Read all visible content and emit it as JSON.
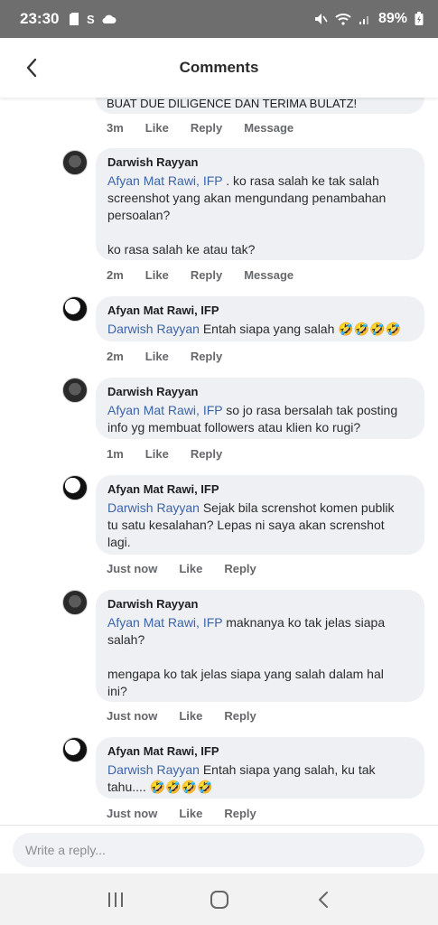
{
  "status_bar": {
    "time": "23:30",
    "battery": "89%"
  },
  "header": {
    "title": "Comments",
    "back_icon": "chevron-left-icon"
  },
  "cut_comment_text": "BUAT DUE DILIGENCE DAN TERIMA BULATZ!",
  "actions": {
    "like": "Like",
    "reply": "Reply",
    "message": "Message"
  },
  "comments": [
    {
      "time": "3m"
    },
    {
      "author": "Darwish Rayyan",
      "mention": "Afyan Mat Rawi, IFP",
      "lines": [
        " . ko rasa salah ke tak salah",
        "screenshot yang akan mengundang penambahan",
        "persoalan?",
        "",
        "ko rasa salah ke atau tak?"
      ],
      "time": "2m"
    },
    {
      "author": "Afyan Mat Rawi, IFP",
      "mention": "Darwish Rayyan",
      "lines": [
        " Entah siapa yang salah 🤣🤣🤣🤣"
      ],
      "time": "2m"
    },
    {
      "author": "Darwish Rayyan",
      "mention": "Afyan Mat Rawi, IFP",
      "lines": [
        " so jo rasa  bersalah tak posting",
        "info yg membuat followers atau klien ko rugi?"
      ],
      "time": "1m"
    },
    {
      "author": "Afyan Mat Rawi, IFP",
      "mention": "Darwish Rayyan",
      "lines": [
        " Sejak bila screnshot komen publik",
        "tu satu kesalahan? Lepas ni saya akan screnshot",
        "lagi."
      ],
      "time": "Just now"
    },
    {
      "author": "Darwish Rayyan",
      "mention": "Afyan Mat Rawi, IFP",
      "lines": [
        " maknanya ko tak jelas siapa",
        "salah?",
        "",
        "mengapa ko tak jelas siapa yang salah dalam hal",
        "ini?"
      ],
      "time": "Just now"
    },
    {
      "author": "Afyan Mat Rawi, IFP",
      "mention": "Darwish Rayyan",
      "lines": [
        " Entah siapa yang salah, ku tak",
        "tahu.... 🤣🤣🤣🤣"
      ],
      "time": "Just now"
    }
  ],
  "reply": {
    "placeholder": "Write a reply..."
  },
  "nav": {
    "recents_icon": "recents-icon",
    "home_icon": "home-icon",
    "back_icon": "back-icon"
  }
}
